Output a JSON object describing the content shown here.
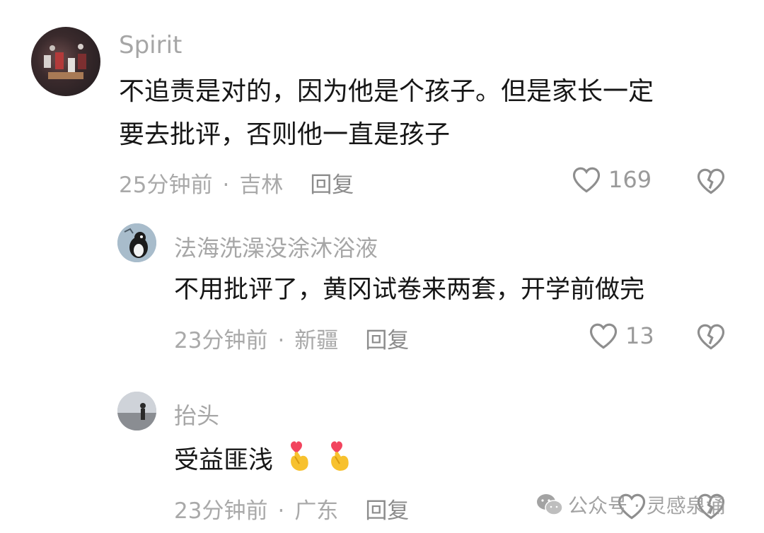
{
  "comments": [
    {
      "username": "Spirit",
      "lines": [
        "不追责是对的，因为他是个孩子。但是家长一定",
        "要去批评，否则他一直是孩子"
      ],
      "time": "25分钟前",
      "location": "吉林",
      "reply_label": "回复",
      "likes": "169"
    },
    {
      "username": "法海洗澡没涂沐浴液",
      "lines": [
        "不用批评了，黄冈试卷来两套，开学前做完"
      ],
      "time": "23分钟前",
      "location": "新疆",
      "reply_label": "回复",
      "likes": "13"
    },
    {
      "username": "抬头",
      "lines": [
        "受益匪浅"
      ],
      "time": "23分钟前",
      "location": "广东",
      "reply_label": "回复",
      "likes": ""
    }
  ],
  "separator": "·",
  "watermark": "公众号 · 灵感泉涌",
  "icons": [
    "heart-outline-icon",
    "broken-heart-icon",
    "finger-heart-emoji",
    "wechat-icon"
  ]
}
